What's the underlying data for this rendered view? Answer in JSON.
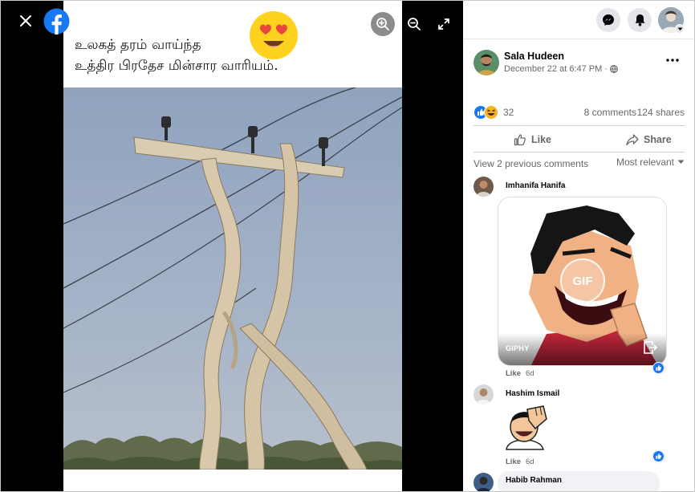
{
  "viewer": {
    "caption_line1": "உலகத் தரம் வாய்ந்த",
    "caption_line2": "உத்திர பிரதேச மின்சார வாரியம்."
  },
  "post": {
    "author": "Sala Hudeen",
    "timestamp": "December 22 at 6:47 PM",
    "reaction_count": "32",
    "comments_count": "8 comments",
    "shares_count": "124 shares",
    "like_label": "Like",
    "share_label": "Share",
    "view_previous": "View 2 previous comments",
    "sort_label": "Most relevant"
  },
  "comments": [
    {
      "name": "Imhanifa Hanifa",
      "gif_label": "GIF",
      "gif_source": "GIPHY",
      "like_label": "Like",
      "age": "6d"
    },
    {
      "name": "Hashim Ismail",
      "like_label": "Like",
      "age": "6d"
    },
    {
      "name": "Habib Rahman"
    }
  ],
  "colors": {
    "facebook_blue": "#1877f2",
    "sky": "#9fb0c6",
    "like_blue": "#1877f2"
  },
  "icons": [
    "close-icon",
    "facebook-logo",
    "zoom-in-icon",
    "zoom-out-icon",
    "fullscreen-icon",
    "messenger-icon",
    "bell-icon",
    "globe-icon",
    "more-icon",
    "thumbs-up-icon",
    "share-icon",
    "caret-down-icon"
  ]
}
